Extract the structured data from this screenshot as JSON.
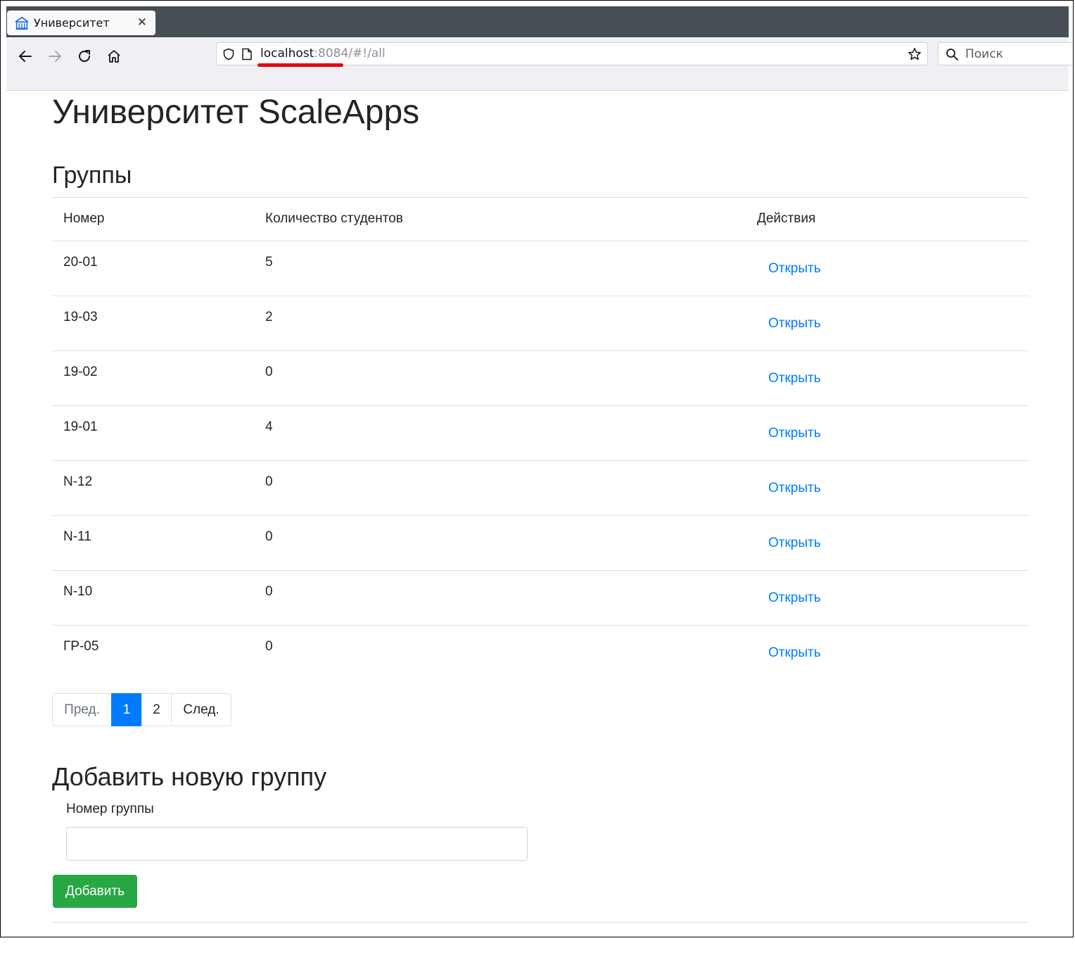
{
  "browser": {
    "tab_title": "Университет",
    "url_host": "localhost",
    "url_rest": ":8084/#!/all",
    "search_placeholder": "Поиск"
  },
  "page": {
    "title": "Университет ScaleApps",
    "groups_heading": "Группы"
  },
  "table": {
    "headers": [
      "Номер",
      "Количество студентов",
      "Действия"
    ],
    "rows": [
      {
        "number": "20-01",
        "count": "5",
        "action": "Открыть"
      },
      {
        "number": "19-03",
        "count": "2",
        "action": "Открыть"
      },
      {
        "number": "19-02",
        "count": "0",
        "action": "Открыть"
      },
      {
        "number": "19-01",
        "count": "4",
        "action": "Открыть"
      },
      {
        "number": "N-12",
        "count": "0",
        "action": "Открыть"
      },
      {
        "number": "N-11",
        "count": "0",
        "action": "Открыть"
      },
      {
        "number": "N-10",
        "count": "0",
        "action": "Открыть"
      },
      {
        "number": "ГР-05",
        "count": "0",
        "action": "Открыть"
      }
    ]
  },
  "pagination": {
    "prev": "Пред.",
    "pages": [
      "1",
      "2"
    ],
    "active_page": "1",
    "next": "След."
  },
  "add_form": {
    "heading": "Добавить новую группу",
    "label": "Номер группы",
    "value": "",
    "button": "Добавить"
  },
  "colors": {
    "link": "#007bff",
    "active_page": "#007bff",
    "add_button": "#28a745",
    "url_underline": "#e8000c"
  }
}
